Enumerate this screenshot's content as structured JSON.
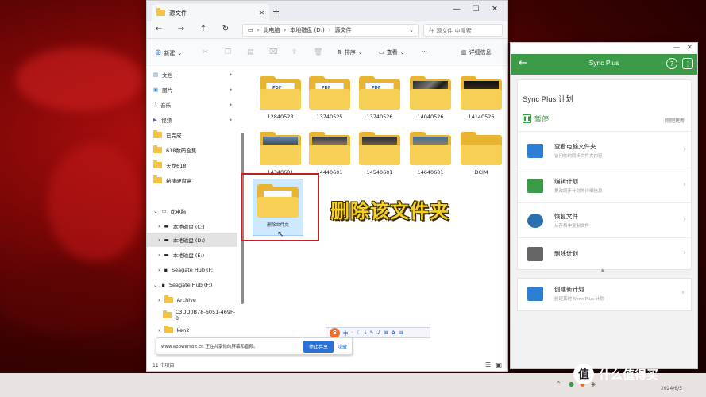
{
  "explorer": {
    "tab_title": "源文件",
    "path": [
      "此电脑",
      "本地磁盘 (D:)",
      "源文件"
    ],
    "search_placeholder": "在 源文件 中搜索",
    "toolbar": {
      "new": "新建",
      "sort": "排序",
      "view": "查看",
      "details": "详细信息"
    },
    "nav": [
      {
        "label": "文档",
        "pinned": true
      },
      {
        "label": "图片",
        "pinned": true
      },
      {
        "label": "音乐",
        "pinned": true
      },
      {
        "label": "视频",
        "pinned": true
      },
      {
        "label": "已完成"
      },
      {
        "label": "618数码合集"
      },
      {
        "label": "天龙618"
      },
      {
        "label": "希捷硬盘盒"
      },
      {
        "label": "此电脑"
      },
      {
        "label": "本地磁盘 (C:)"
      },
      {
        "label": "本地磁盘 (D:)",
        "selected": true
      },
      {
        "label": "本地磁盘 (E:)"
      },
      {
        "label": "Seagate Hub (F:)"
      },
      {
        "label": "Seagate Hub (F:)"
      },
      {
        "label": "Archive"
      },
      {
        "label": "C3DD0B78-6051-469F-8"
      },
      {
        "label": "ken2"
      }
    ],
    "files": [
      {
        "name": "12840523"
      },
      {
        "name": "13740525"
      },
      {
        "name": "13740526"
      },
      {
        "name": "14040526"
      },
      {
        "name": "14140526"
      },
      {
        "name": "14340601"
      },
      {
        "name": "14440601"
      },
      {
        "name": "14540601"
      },
      {
        "name": "14640601"
      },
      {
        "name": "DCIM"
      },
      {
        "name": "删除文件夹"
      }
    ],
    "annotation": "删除该文件夹",
    "status": "11 个项目",
    "share_bar": {
      "text": "www.apowersoft.cn 正在共享你的屏幕和音频。",
      "stop": "停止共享",
      "hide": "隐藏"
    },
    "ime": {
      "logo": "S",
      "items": [
        "中",
        "·",
        "☾",
        "♩",
        "✎",
        "♪",
        "⊞",
        "✿",
        "⊟"
      ]
    }
  },
  "sync": {
    "title": "Sync Plus",
    "plan_title": "Sync Plus 计划",
    "status": "暂停",
    "right_text": "刚刚更新",
    "items": [
      {
        "title": "查看电脑文件夹",
        "desc": "访问你的同步文件夹内容",
        "color": "#2d7fd6"
      },
      {
        "title": "编辑计划",
        "desc": "更改同步计划的详细信息",
        "color": "#3c9b48"
      },
      {
        "title": "恢复文件",
        "desc": "从存档中复制文件",
        "color": "#2a6fb0"
      },
      {
        "title": "删除计划",
        "desc": "",
        "color": "#666666"
      }
    ],
    "new_plan": {
      "title": "创建新计划",
      "desc": "创建其他 Sync Plus 计划"
    }
  },
  "taskbar": {
    "date": "2024/6/5"
  },
  "watermark": {
    "logo": "值",
    "text": "什么值得买"
  }
}
